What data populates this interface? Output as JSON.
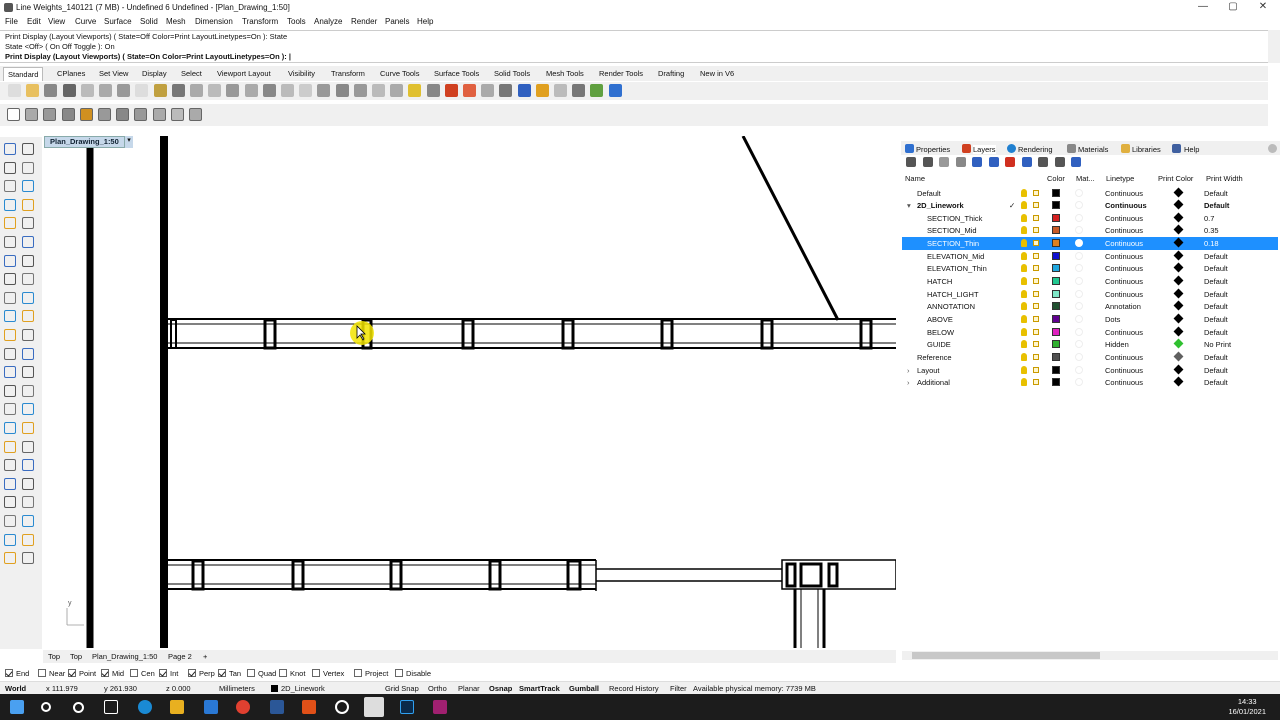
{
  "window": {
    "title": "Line Weights_140121 (7 MB) - Undefined 6 Undefined - [Plan_Drawing_1:50]",
    "minimize": "—",
    "restore": "▢",
    "close": "✕"
  },
  "menu": [
    "File",
    "Edit",
    "View",
    "Curve",
    "Surface",
    "Solid",
    "Mesh",
    "Dimension",
    "Transform",
    "Tools",
    "Analyze",
    "Render",
    "Panels",
    "Help"
  ],
  "command_history": [
    "Print Display (Layout Viewports) ( State=Off  Color=Print  LayoutLinetypes=On ): State",
    "State <Off> ( On  Off  Toggle ): On",
    "Print Display (Layout Viewports) ( State=On  Color=Print  LayoutLinetypes=On ): |"
  ],
  "toolbar_tabs": [
    "Standard",
    "CPlanes",
    "Set View",
    "Display",
    "Select",
    "Viewport Layout",
    "Visibility",
    "Transform",
    "Curve Tools",
    "Surface Tools",
    "Solid Tools",
    "Mesh Tools",
    "Render Tools",
    "Drafting",
    "New in V6"
  ],
  "active_toolbar_tab": "Standard",
  "viewport": {
    "tab_label": "Plan_Drawing_1:50",
    "dropdown": "▾",
    "axis_label": "y"
  },
  "bottom_tabs": [
    "Top",
    "Top",
    "Plan_Drawing_1:50",
    "Page 2",
    "+"
  ],
  "panel": {
    "tabs": [
      "Properties",
      "Layers",
      "Rendering",
      "Materials",
      "Libraries",
      "Help"
    ],
    "columns": {
      "name": "Name",
      "color": "Color",
      "material": "Mat...",
      "linetype": "Linetype",
      "print_color": "Print Color",
      "print_width": "Print Width"
    },
    "layers": [
      {
        "name": "Default",
        "color": "#000000",
        "linetype": "Continuous",
        "print_color": "#000000",
        "print_width": "Default",
        "indent": 0,
        "expander": "",
        "current": "",
        "bold": false,
        "selected": false
      },
      {
        "name": "2D_Linework",
        "color": "#000000",
        "linetype": "Continuous",
        "print_color": "#000000",
        "print_width": "Default",
        "indent": 0,
        "expander": "▾",
        "current": "✓",
        "bold": true,
        "selected": false
      },
      {
        "name": "SECTION_Thick",
        "color": "#d42020",
        "linetype": "Continuous",
        "print_color": "#000000",
        "print_width": "0.7",
        "indent": 1,
        "expander": "",
        "current": "",
        "bold": false,
        "selected": false
      },
      {
        "name": "SECTION_Mid",
        "color": "#c85a28",
        "linetype": "Continuous",
        "print_color": "#000000",
        "print_width": "0.35",
        "indent": 1,
        "expander": "",
        "current": "",
        "bold": false,
        "selected": false
      },
      {
        "name": "SECTION_Thin",
        "color": "#e08020",
        "linetype": "Continuous",
        "print_color": "#000000",
        "print_width": "0.18",
        "indent": 1,
        "expander": "",
        "current": "",
        "bold": false,
        "selected": true
      },
      {
        "name": "ELEVATION_Mid",
        "color": "#1010d0",
        "linetype": "Continuous",
        "print_color": "#000000",
        "print_width": "Default",
        "indent": 1,
        "expander": "",
        "current": "",
        "bold": false,
        "selected": false
      },
      {
        "name": "ELEVATION_Thin",
        "color": "#20a8e0",
        "linetype": "Continuous",
        "print_color": "#000000",
        "print_width": "Default",
        "indent": 1,
        "expander": "",
        "current": "",
        "bold": false,
        "selected": false
      },
      {
        "name": "HATCH",
        "color": "#20c890",
        "linetype": "Continuous",
        "print_color": "#000000",
        "print_width": "Default",
        "indent": 1,
        "expander": "",
        "current": "",
        "bold": false,
        "selected": false
      },
      {
        "name": "HATCH_LIGHT",
        "color": "#80e8c8",
        "linetype": "Continuous",
        "print_color": "#000000",
        "print_width": "Default",
        "indent": 1,
        "expander": "",
        "current": "",
        "bold": false,
        "selected": false
      },
      {
        "name": "ANNOTATION",
        "color": "#205030",
        "linetype": "Annotation",
        "print_color": "#000000",
        "print_width": "Default",
        "indent": 1,
        "expander": "",
        "current": "",
        "bold": false,
        "selected": false
      },
      {
        "name": "ABOVE",
        "color": "#600090",
        "linetype": "Dots",
        "print_color": "#000000",
        "print_width": "Default",
        "indent": 1,
        "expander": "",
        "current": "",
        "bold": false,
        "selected": false
      },
      {
        "name": "BELOW",
        "color": "#e020c0",
        "linetype": "Continuous",
        "print_color": "#000000",
        "print_width": "Default",
        "indent": 1,
        "expander": "",
        "current": "",
        "bold": false,
        "selected": false
      },
      {
        "name": "GUIDE",
        "color": "#30b030",
        "linetype": "Hidden",
        "print_color": "#30c030",
        "print_width": "No Print",
        "indent": 1,
        "expander": "",
        "current": "",
        "bold": false,
        "selected": false
      },
      {
        "name": "Reference",
        "color": "#505050",
        "linetype": "Continuous",
        "print_color": "#606060",
        "print_width": "Default",
        "indent": 0,
        "expander": "",
        "current": "",
        "bold": false,
        "selected": false
      },
      {
        "name": "Layout",
        "color": "#000000",
        "linetype": "Continuous",
        "print_color": "#000000",
        "print_width": "Default",
        "indent": 0,
        "expander": "›",
        "current": "",
        "bold": false,
        "selected": false
      },
      {
        "name": "Additional",
        "color": "#000000",
        "linetype": "Continuous",
        "print_color": "#000000",
        "print_width": "Default",
        "indent": 0,
        "expander": "›",
        "current": "",
        "bold": false,
        "selected": false
      }
    ]
  },
  "osnap": [
    {
      "label": "End",
      "checked": true
    },
    {
      "label": "Near",
      "checked": false
    },
    {
      "label": "Point",
      "checked": true
    },
    {
      "label": "Mid",
      "checked": true
    },
    {
      "label": "Cen",
      "checked": false
    },
    {
      "label": "Int",
      "checked": true
    },
    {
      "label": "Perp",
      "checked": true
    },
    {
      "label": "Tan",
      "checked": true
    },
    {
      "label": "Quad",
      "checked": false
    },
    {
      "label": "Knot",
      "checked": false
    },
    {
      "label": "Vertex",
      "checked": false
    },
    {
      "label": "Project",
      "checked": false
    },
    {
      "label": "Disable",
      "checked": false
    }
  ],
  "status": {
    "cplane": "World",
    "x": "x 111.979",
    "y": "y 261.930",
    "z": "z 0.000",
    "units": "Millimeters",
    "layer": "2D_Linework",
    "grid_snap": "Grid Snap",
    "ortho": "Ortho",
    "planar": "Planar",
    "osnap": "Osnap",
    "smarttrack": "SmartTrack",
    "gumball": "Gumball",
    "record_history": "Record History",
    "filter": "Filter",
    "memory": "Available physical memory: 7739 MB"
  },
  "taskbar": {
    "time": "14:33",
    "date": "16/01/2021"
  },
  "colors": {
    "selection": "#1e90ff",
    "toolbar_bg": "#f0f0f0",
    "taskbar_bg": "#1c1c1c",
    "cursor_highlight": "#f2e400"
  }
}
